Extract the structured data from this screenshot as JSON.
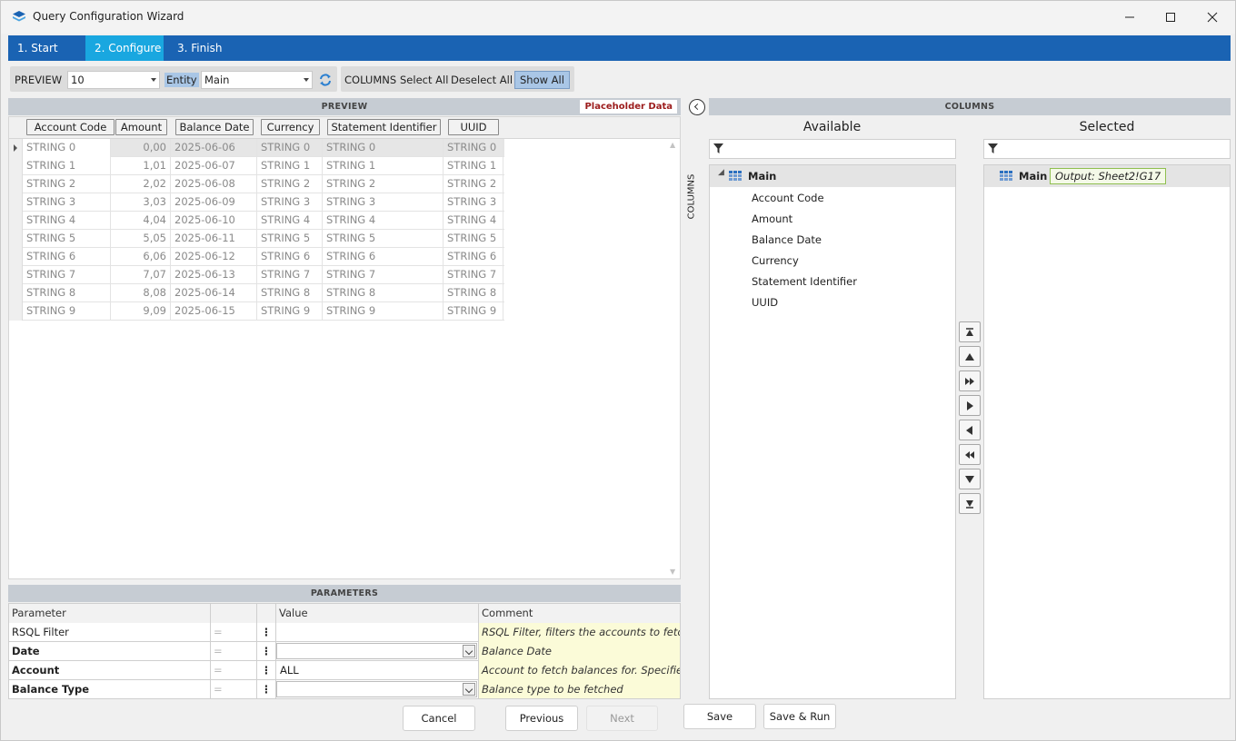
{
  "window": {
    "title": "Query Configuration Wizard",
    "app_icon": "layers-icon",
    "controls": [
      "minimize-icon",
      "maximize-icon",
      "close-icon"
    ]
  },
  "tabs": [
    {
      "label": "1. Start",
      "active": false
    },
    {
      "label": "2. Configure",
      "active": true
    },
    {
      "label": "3. Finish",
      "active": false
    }
  ],
  "toolbar": {
    "preview_label": "PREVIEW",
    "preview_count": "10",
    "entity_label": "Entity",
    "entity_value": "Main",
    "refresh_icon": "refresh-icon",
    "columns_label": "COLUMNS",
    "select_all": "Select All",
    "deselect_all": "Deselect All",
    "show_all": "Show All"
  },
  "preview": {
    "header": "PREVIEW",
    "badge": "Placeholder Data",
    "columns": [
      "Account Code",
      "Amount",
      "Balance Date",
      "Currency",
      "Statement Identifier",
      "UUID"
    ],
    "rows": [
      [
        "STRING 0",
        "0,00",
        "2025-06-06",
        "STRING 0",
        "STRING 0",
        "STRING 0"
      ],
      [
        "STRING 1",
        "1,01",
        "2025-06-07",
        "STRING 1",
        "STRING 1",
        "STRING 1"
      ],
      [
        "STRING 2",
        "2,02",
        "2025-06-08",
        "STRING 2",
        "STRING 2",
        "STRING 2"
      ],
      [
        "STRING 3",
        "3,03",
        "2025-06-09",
        "STRING 3",
        "STRING 3",
        "STRING 3"
      ],
      [
        "STRING 4",
        "4,04",
        "2025-06-10",
        "STRING 4",
        "STRING 4",
        "STRING 4"
      ],
      [
        "STRING 5",
        "5,05",
        "2025-06-11",
        "STRING 5",
        "STRING 5",
        "STRING 5"
      ],
      [
        "STRING 6",
        "6,06",
        "2025-06-12",
        "STRING 6",
        "STRING 6",
        "STRING 6"
      ],
      [
        "STRING 7",
        "7,07",
        "2025-06-13",
        "STRING 7",
        "STRING 7",
        "STRING 7"
      ],
      [
        "STRING 8",
        "8,08",
        "2025-06-14",
        "STRING 8",
        "STRING 8",
        "STRING 8"
      ],
      [
        "STRING 9",
        "9,09",
        "2025-06-15",
        "STRING 9",
        "STRING 9",
        "STRING 9"
      ]
    ]
  },
  "parameters": {
    "header": "PARAMETERS",
    "col_parameter": "Parameter",
    "col_value": "Value",
    "col_comment": "Comment",
    "eq_symbol": "=",
    "dots_symbol": "⋮",
    "rows": [
      {
        "name": "RSQL Filter",
        "bold": false,
        "value": "",
        "type": "text",
        "comment": "RSQL Filter, filters the accounts to fetch b"
      },
      {
        "name": "Date",
        "bold": true,
        "value": "",
        "type": "combo",
        "comment": "Balance Date"
      },
      {
        "name": "Account",
        "bold": true,
        "value": "ALL",
        "type": "text",
        "comment": "Account to fetch balances for. Specified b"
      },
      {
        "name": "Balance Type",
        "bold": true,
        "value": "",
        "type": "combo",
        "comment": "Balance type to be fetched"
      }
    ]
  },
  "footer": {
    "cancel": "Cancel",
    "previous": "Previous",
    "next": "Next",
    "save": "Save",
    "save_run": "Save & Run"
  },
  "columns_panel": {
    "header": "COLUMNS",
    "side_label": "COLUMNS",
    "available_title": "Available",
    "selected_title": "Selected",
    "available_root": "Main",
    "available_items": [
      "Account Code",
      "Amount",
      "Balance Date",
      "Currency",
      "Statement Identifier",
      "UUID"
    ],
    "selected_root": "Main",
    "output": "Output: Sheet2!G17",
    "move_buttons": [
      "move-top-icon",
      "move-up-icon",
      "add-all-icon",
      "add-icon",
      "remove-icon",
      "remove-all-icon",
      "move-down-icon",
      "move-bottom-icon"
    ]
  }
}
